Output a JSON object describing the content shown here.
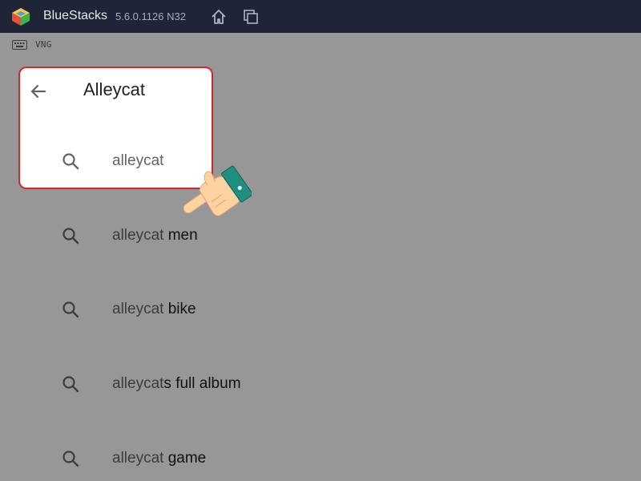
{
  "titlebar": {
    "app_name": "BlueStacks",
    "version": "5.6.0.1126 N32",
    "icons": [
      "bluestacks-logo-icon",
      "home-icon",
      "multi-instance-icon"
    ]
  },
  "ime": {
    "icon": "keyboard-icon",
    "label": "VNG"
  },
  "search": {
    "query": "Alleycat",
    "back_icon": "arrow-back-icon"
  },
  "suggestions": [
    {
      "typed": "alleycat",
      "rest": "",
      "highlighted": true
    },
    {
      "typed": "alleycat",
      "rest": " men",
      "highlighted": false
    },
    {
      "typed": "alleycat",
      "rest": " bike",
      "highlighted": false
    },
    {
      "typed": "alleycat",
      "rest": "s full album",
      "highlighted": false
    },
    {
      "typed": "alleycat",
      "rest": " game",
      "highlighted": false
    }
  ],
  "colors": {
    "titlebar_bg": "#1f2437",
    "overlay_bg": "#979797",
    "highlight_border": "#d9262b",
    "hand_cuff": "#1f8f7f"
  }
}
